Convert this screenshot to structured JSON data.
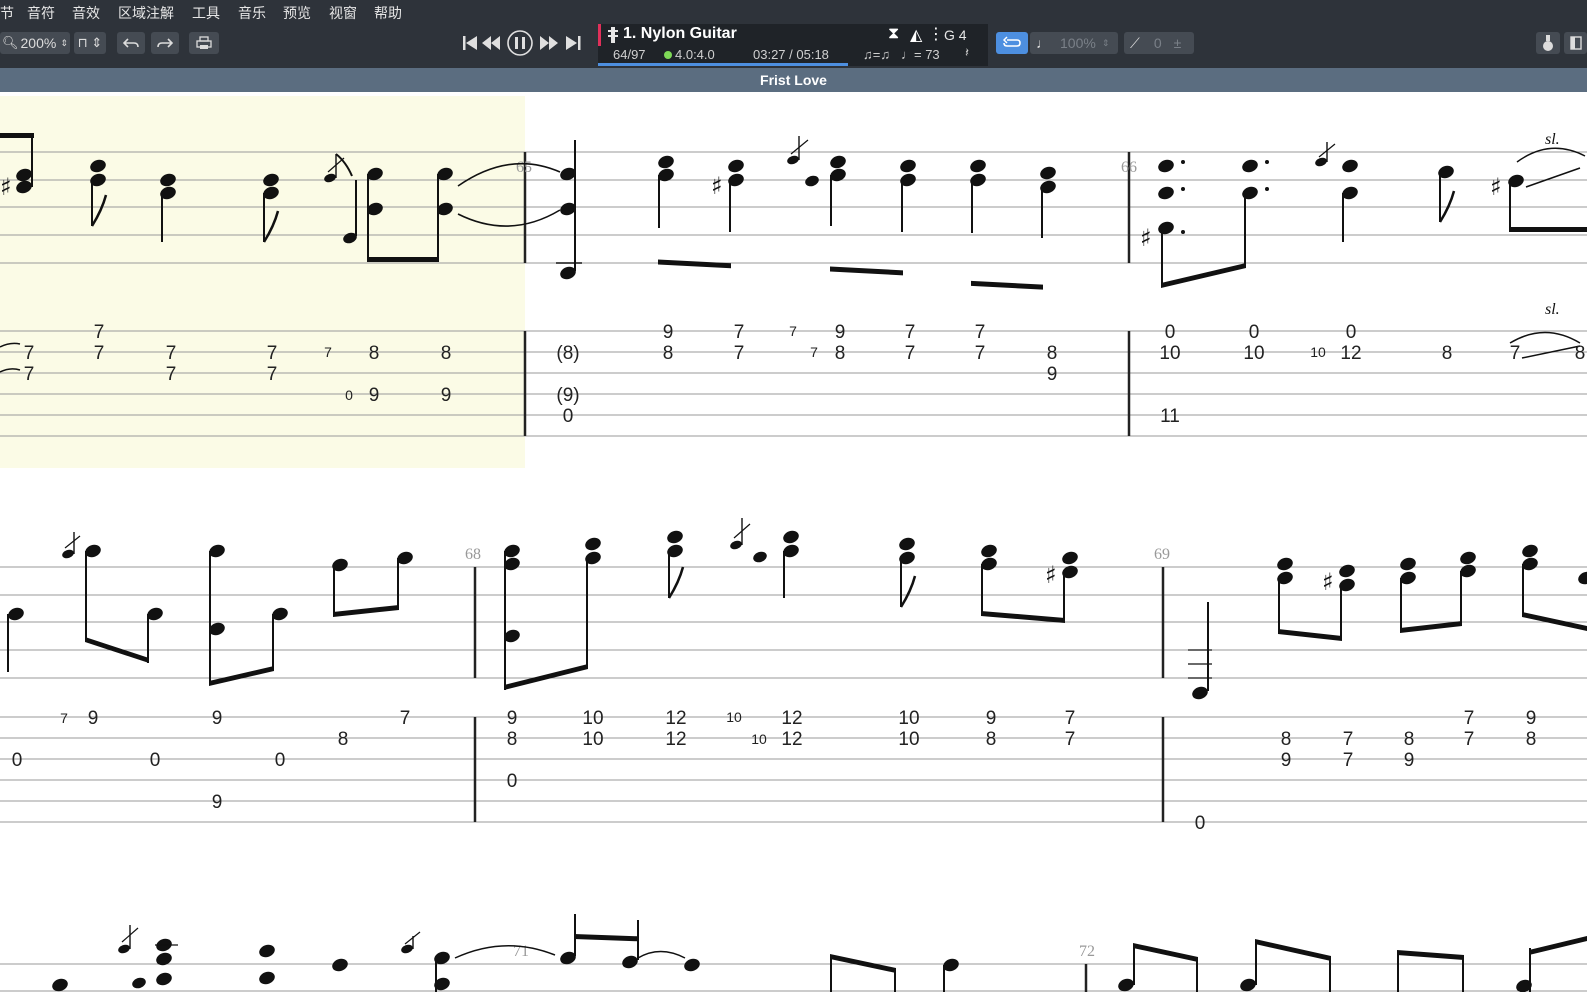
{
  "menu": [
    "节",
    "音符",
    "音效",
    "区域注解",
    "工具",
    "音乐",
    "预览",
    "视窗",
    "帮助"
  ],
  "toolbar": {
    "zoom": "200%",
    "track_name": "1. Nylon Guitar",
    "bar_position": "64/97",
    "beat_position": "4.0:4.0",
    "time": "03:27 / 05:18",
    "tempo": "♩= 73",
    "swing": "♫=♫",
    "key": "G 4",
    "speed": "100%",
    "tuning": "0"
  },
  "score": {
    "title": "Frist Love",
    "measure_numbers": [
      "65",
      "66",
      "68",
      "69",
      "71",
      "72"
    ],
    "slide_label": "sl.",
    "system1_tab": [
      [
        "7",
        "7",
        "7",
        "7",
        "7",
        "7",
        "8",
        "8",
        "9",
        "7",
        "7",
        "9",
        "7",
        "7",
        "0",
        "0",
        "0",
        "7"
      ],
      [
        "7",
        "7",
        "7",
        "7",
        "8",
        "8",
        "(8)",
        "8",
        "7",
        "7",
        "8",
        "7",
        "7",
        "8",
        "10",
        "10",
        "10",
        "12",
        "8",
        "7",
        "8"
      ],
      [
        "0",
        "9",
        "9",
        "(9)",
        "9"
      ],
      [
        "0",
        "11"
      ]
    ],
    "system2_tab": [
      [
        "7",
        "9",
        "9",
        "7",
        "9",
        "10",
        "12",
        "10",
        "12",
        "10",
        "9",
        "7",
        "7",
        "9"
      ],
      [
        "8",
        "8",
        "10",
        "12",
        "10",
        "12",
        "10",
        "8",
        "7",
        "8",
        "7",
        "8",
        "7",
        "8"
      ],
      [
        "0",
        "0",
        "0",
        "0",
        "9",
        "7",
        "9"
      ],
      [
        "9",
        "0"
      ]
    ]
  }
}
